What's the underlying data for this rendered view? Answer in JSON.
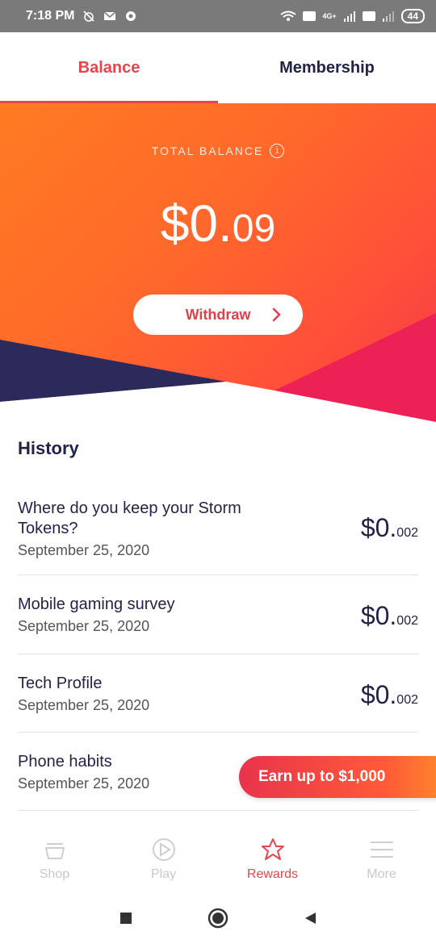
{
  "status_bar": {
    "time": "7:18 PM",
    "net_label": "4G+",
    "battery": "44"
  },
  "tabs": {
    "balance": "Balance",
    "membership": "Membership"
  },
  "balance": {
    "label": "TOTAL BALANCE",
    "amount_main": "$0.",
    "amount_cents": "09",
    "withdraw_label": "Withdraw"
  },
  "history": {
    "title": "History",
    "items": [
      {
        "title": "Where do you keep your Storm Tokens?",
        "date": "September 25, 2020",
        "amount_main": "$0.",
        "amount_small": "002"
      },
      {
        "title": "Mobile gaming survey",
        "date": "September 25, 2020",
        "amount_main": "$0.",
        "amount_small": "002"
      },
      {
        "title": "Tech Profile",
        "date": "September 25, 2020",
        "amount_main": "$0.",
        "amount_small": "002"
      },
      {
        "title": "Phone habits",
        "date": "September 25, 2020",
        "amount_main": "",
        "amount_small": ""
      }
    ]
  },
  "earn_button": "Earn up to $1,000",
  "bottom_nav": {
    "shop": "Shop",
    "play": "Play",
    "rewards": "Rewards",
    "more": "More"
  },
  "colors": {
    "accent": "#e8454a",
    "navy": "#23234a",
    "orange": "#ff7a22"
  }
}
